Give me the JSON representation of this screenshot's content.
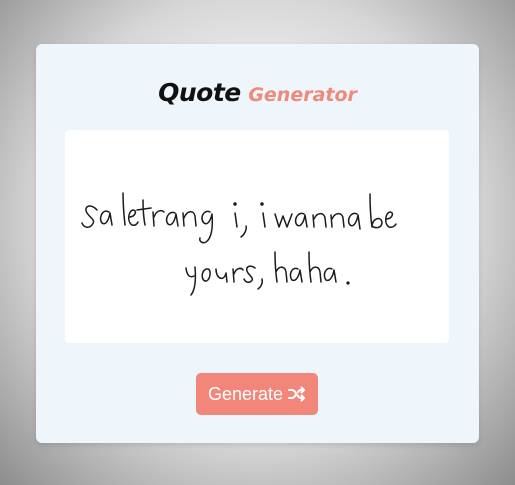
{
  "header": {
    "title_word1": "Quote",
    "title_word2": "Generator"
  },
  "quote": {
    "text": "sa letrang i, i wanna be yours, haha."
  },
  "actions": {
    "generate_label": "Generate",
    "generate_icon": "shuffle-icon"
  },
  "colors": {
    "accent": "#f3867a",
    "card_bg": "#eef5fb",
    "quote_bg": "#ffffff"
  }
}
